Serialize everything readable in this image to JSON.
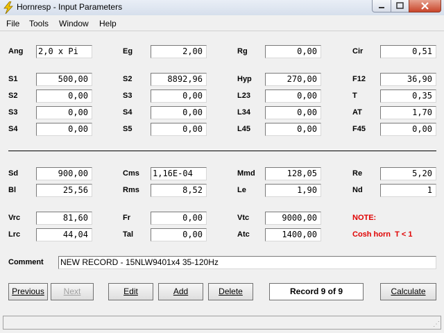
{
  "window": {
    "title": "Hornresp - Input Parameters"
  },
  "menu": [
    "File",
    "Tools",
    "Window",
    "Help"
  ],
  "params": {
    "Ang": {
      "label": "Ang",
      "value": "2,0 x Pi"
    },
    "Eg": {
      "label": "Eg",
      "value": "2,00"
    },
    "Rg": {
      "label": "Rg",
      "value": "0,00"
    },
    "Cir": {
      "label": "Cir",
      "value": "0,51"
    },
    "S1a": {
      "label": "S1",
      "value": "500,00"
    },
    "S2a": {
      "label": "S2",
      "value": "8892,96"
    },
    "Hyp": {
      "label": "Hyp",
      "value": "270,00"
    },
    "F12": {
      "label": "F12",
      "value": "36,90"
    },
    "S2b": {
      "label": "S2",
      "value": "0,00"
    },
    "S3a": {
      "label": "S3",
      "value": "0,00"
    },
    "L23": {
      "label": "L23",
      "value": "0,00"
    },
    "T": {
      "label": "T",
      "value": "0,35"
    },
    "S3b": {
      "label": "S3",
      "value": "0,00"
    },
    "S4a": {
      "label": "S4",
      "value": "0,00"
    },
    "L34": {
      "label": "L34",
      "value": "0,00"
    },
    "AT": {
      "label": "AT",
      "value": "1,70"
    },
    "S4b": {
      "label": "S4",
      "value": "0,00"
    },
    "S5": {
      "label": "S5",
      "value": "0,00"
    },
    "L45": {
      "label": "L45",
      "value": "0,00"
    },
    "F45": {
      "label": "F45",
      "value": "0,00"
    },
    "Sd": {
      "label": "Sd",
      "value": "900,00"
    },
    "Cms": {
      "label": "Cms",
      "value": "1,16E-04"
    },
    "Mmd": {
      "label": "Mmd",
      "value": "128,05"
    },
    "Re": {
      "label": "Re",
      "value": "5,20"
    },
    "Bl": {
      "label": "Bl",
      "value": "25,56"
    },
    "Rms": {
      "label": "Rms",
      "value": "8,52"
    },
    "Le": {
      "label": "Le",
      "value": "1,90"
    },
    "Nd": {
      "label": "Nd",
      "value": "1"
    },
    "Vrc": {
      "label": "Vrc",
      "value": "81,60"
    },
    "Fr": {
      "label": "Fr",
      "value": "0,00"
    },
    "Vtc": {
      "label": "Vtc",
      "value": "9000,00"
    },
    "Lrc": {
      "label": "Lrc",
      "value": "44,04"
    },
    "Tal": {
      "label": "Tal",
      "value": "0,00"
    },
    "Atc": {
      "label": "Atc",
      "value": "1400,00"
    }
  },
  "note": {
    "title": "NOTE:",
    "text": "Cosh horn  T < 1"
  },
  "comment": {
    "label": "Comment",
    "value": "NEW RECORD - 15NLW9401x4 35-120Hz"
  },
  "buttons": {
    "previous": "Previous",
    "next": "Next",
    "edit": "Edit",
    "add": "Add",
    "delete": "Delete",
    "calculate": "Calculate"
  },
  "record": "Record 9 of 9",
  "colors": {
    "note_red": "#e00000"
  },
  "icons": {
    "app": "lightning-bolt-icon"
  }
}
